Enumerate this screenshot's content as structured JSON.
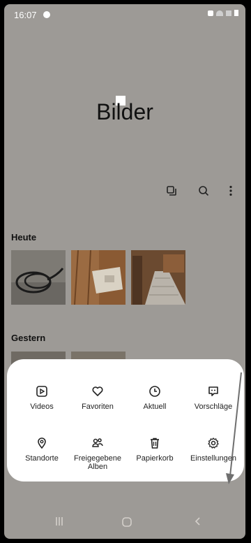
{
  "status_bar": {
    "time": "16:07"
  },
  "header": {
    "title": "Bilder"
  },
  "toolbar": {
    "icons": [
      "multi-select-icon",
      "search-icon",
      "more-options-icon"
    ]
  },
  "sections": [
    {
      "label": "Heute",
      "thumbnails": [
        "cable-photo",
        "box-photo",
        "stairs-photo"
      ]
    },
    {
      "label": "Gestern"
    }
  ],
  "menu": {
    "items": [
      {
        "label": "Videos",
        "icon": "play-icon"
      },
      {
        "label": "Favoriten",
        "icon": "heart-icon"
      },
      {
        "label": "Aktuell",
        "icon": "clock-icon"
      },
      {
        "label": "Vorschläge",
        "icon": "suggestion-icon"
      },
      {
        "label": "Standorte",
        "icon": "location-icon"
      },
      {
        "label": "Freigegebene Alben",
        "icon": "shared-albums-icon"
      },
      {
        "label": "Papierkorb",
        "icon": "trash-icon"
      },
      {
        "label": "Einstellungen",
        "icon": "gear-icon"
      }
    ]
  },
  "navbar": {
    "icons": [
      "recent-apps-icon",
      "home-icon",
      "back-icon"
    ]
  }
}
